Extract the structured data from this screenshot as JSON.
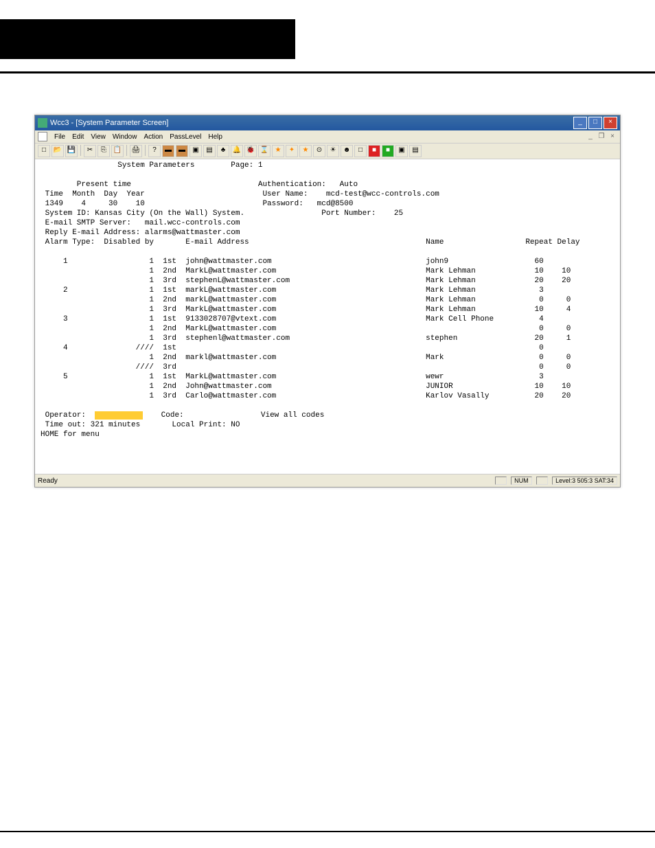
{
  "window": {
    "title": "Wcc3 - [System Parameter Screen]",
    "menu": [
      "File",
      "Edit",
      "View",
      "Window",
      "Action",
      "PassLevel",
      "Help"
    ],
    "status_left": "Ready",
    "status_num": "NUM",
    "status_level": "Level:3 505:3  SAT:34"
  },
  "header": {
    "title": "System Parameters",
    "page": "Page: 1"
  },
  "info": {
    "present_time_label": "Present time",
    "time_header": "Time  Month  Day  Year",
    "time_val": "1349",
    "month_val": "4",
    "day_val": "30",
    "year_val": "10",
    "system_id_label": "System ID:",
    "system_id": "Kansas City (On the Wall) System.",
    "smtp_label": "E-mail SMTP Server:",
    "smtp": "mail.wcc-controls.com",
    "reply_label": "Reply E-mail Address:",
    "reply": "alarms@wattmaster.com",
    "auth_label": "Authentication:",
    "auth": "Auto",
    "user_label": "User Name:",
    "user": "mcd-test@wcc-controls.com",
    "pass_label": "Password:",
    "pass": "mcd@8500",
    "port_label": "Port Number:",
    "port": "25"
  },
  "table": {
    "col_alarm": "Alarm Type:",
    "col_disabled": "Disabled by",
    "col_email": "E-mail Address",
    "col_name": "Name",
    "col_repeat": "Repeat",
    "col_delay": "Delay",
    "rows": [
      {
        "at": "1",
        "db": "1",
        "ord": "1st",
        "email": "john@wattmaster.com",
        "name": "john9",
        "rep": "60",
        "del": ""
      },
      {
        "at": "",
        "db": "1",
        "ord": "2nd",
        "email": "MarkL@wattmaster.com",
        "name": "Mark Lehman",
        "rep": "10",
        "del": "10"
      },
      {
        "at": "",
        "db": "1",
        "ord": "3rd",
        "email": "stephenL@wattmaster.com",
        "name": "Mark Lehman",
        "rep": "20",
        "del": "20"
      },
      {
        "at": "2",
        "db": "1",
        "ord": "1st",
        "email": "markL@wattmaster.com",
        "name": "Mark Lehman",
        "rep": "3",
        "del": ""
      },
      {
        "at": "",
        "db": "1",
        "ord": "2nd",
        "email": "markL@wattmaster.com",
        "name": "Mark Lehman",
        "rep": "0",
        "del": "0"
      },
      {
        "at": "",
        "db": "1",
        "ord": "3rd",
        "email": "MarkL@wattmaster.com",
        "name": "Mark Lehman",
        "rep": "10",
        "del": "4"
      },
      {
        "at": "3",
        "db": "1",
        "ord": "1st",
        "email": "9133028707@vtext.com",
        "name": "Mark Cell Phone",
        "rep": "4",
        "del": ""
      },
      {
        "at": "",
        "db": "1",
        "ord": "2nd",
        "email": "MarkL@wattmaster.com",
        "name": "",
        "rep": "0",
        "del": "0"
      },
      {
        "at": "",
        "db": "1",
        "ord": "3rd",
        "email": "stephenl@wattmaster.com",
        "name": "stephen",
        "rep": "20",
        "del": "1"
      },
      {
        "at": "4",
        "db": "////",
        "ord": "1st",
        "email": "",
        "name": "",
        "rep": "0",
        "del": ""
      },
      {
        "at": "",
        "db": "1",
        "ord": "2nd",
        "email": "markl@wattmaster.com",
        "name": "Mark",
        "rep": "0",
        "del": "0"
      },
      {
        "at": "",
        "db": "////",
        "ord": "3rd",
        "email": "",
        "name": "",
        "rep": "0",
        "del": "0"
      },
      {
        "at": "5",
        "db": "1",
        "ord": "1st",
        "email": "MarkL@wattmaster.com",
        "name": "wewr",
        "rep": "3",
        "del": ""
      },
      {
        "at": "",
        "db": "1",
        "ord": "2nd",
        "email": "John@wattmaster.com",
        "name": "JUNIOR",
        "rep": "10",
        "del": "10"
      },
      {
        "at": "",
        "db": "1",
        "ord": "3rd",
        "email": "Carlo@wattmaster.com",
        "name": "Karlov Vasally",
        "rep": "20",
        "del": "20"
      }
    ]
  },
  "footer": {
    "operator_label": "Operator:",
    "code_label": "Code:",
    "view_codes": "View all codes",
    "timeout_label": "Time out:",
    "timeout": "321 minutes",
    "print_label": "Local Print:",
    "print": "NO",
    "home": "HOME for menu"
  }
}
